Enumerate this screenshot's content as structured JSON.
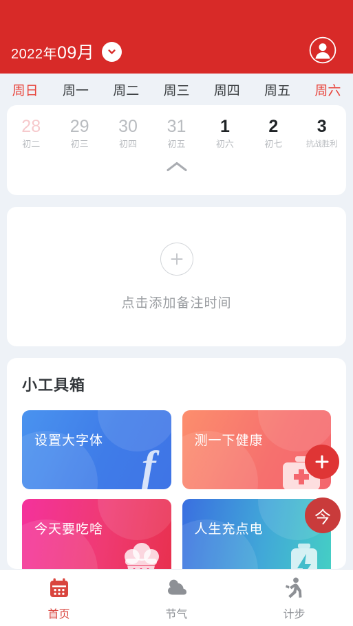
{
  "theme": {
    "brand_red": "#d82a28",
    "accent_red": "#e8453c",
    "page_bg": "#eef2f7",
    "card_bg": "#ffffff",
    "muted_text": "#b9bcc0"
  },
  "header": {
    "year_label": "2022年",
    "month_label": "09月",
    "dropdown_icon": "chevron-down-icon",
    "avatar_icon": "user-avatar-icon"
  },
  "calendar": {
    "weekdays": [
      {
        "label": "周日",
        "weekend": true
      },
      {
        "label": "周一",
        "weekend": false
      },
      {
        "label": "周二",
        "weekend": false
      },
      {
        "label": "周三",
        "weekend": false
      },
      {
        "label": "周四",
        "weekend": false
      },
      {
        "label": "周五",
        "weekend": false
      },
      {
        "label": "周六",
        "weekend": true
      }
    ],
    "days": [
      {
        "num": "28",
        "lunar": "初二",
        "state": "prev-sunday"
      },
      {
        "num": "29",
        "lunar": "初三",
        "state": "prev"
      },
      {
        "num": "30",
        "lunar": "初四",
        "state": "prev"
      },
      {
        "num": "31",
        "lunar": "初五",
        "state": "prev"
      },
      {
        "num": "1",
        "lunar": "初六",
        "state": "current"
      },
      {
        "num": "2",
        "lunar": "初七",
        "state": "current"
      },
      {
        "num": "3",
        "lunar": "抗战胜利",
        "state": "current",
        "lunar_small": true
      }
    ],
    "collapse_icon": "chevron-up-icon"
  },
  "note_card": {
    "add_icon": "plus-circle-icon",
    "label": "点击添加备注时间"
  },
  "toolbox": {
    "title": "小工具箱",
    "tiles": [
      {
        "label": "设置大字体",
        "theme": "t-font",
        "glyph": "font-f-icon"
      },
      {
        "label": "测一下健康",
        "theme": "t-health",
        "glyph": "medical-kit-icon"
      },
      {
        "label": "今天要吃啥",
        "theme": "t-food",
        "glyph": "cupcake-icon"
      },
      {
        "label": "人生充点电",
        "theme": "t-power",
        "glyph": "battery-bolt-icon"
      }
    ]
  },
  "floating_buttons": {
    "add": {
      "icon": "plus-icon",
      "label": "+"
    },
    "today": {
      "label": "今"
    }
  },
  "bottom_nav": {
    "items": [
      {
        "label": "首页",
        "icon": "calendar-icon",
        "active": true
      },
      {
        "label": "节气",
        "icon": "cloud-sun-icon",
        "active": false
      },
      {
        "label": "计步",
        "icon": "running-person-icon",
        "active": false
      }
    ]
  }
}
